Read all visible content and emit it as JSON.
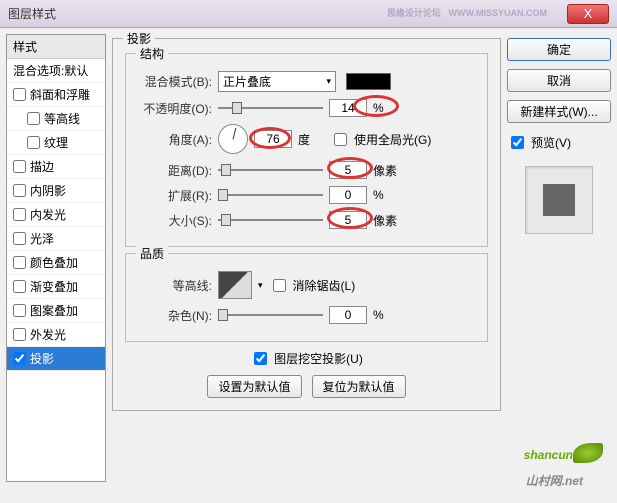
{
  "title": "图层样式",
  "watermark": {
    "text": "思缘设计论坛",
    "url": "WWW.MISSYUAN.COM"
  },
  "close_x": "X",
  "left": {
    "header": "样式",
    "blend_options": "混合选项:默认",
    "items": [
      {
        "label": "斜面和浮雕",
        "indent": false
      },
      {
        "label": "等高线",
        "indent": true
      },
      {
        "label": "纹理",
        "indent": true
      },
      {
        "label": "描边",
        "indent": false
      },
      {
        "label": "内阴影",
        "indent": false
      },
      {
        "label": "内发光",
        "indent": false
      },
      {
        "label": "光泽",
        "indent": false
      },
      {
        "label": "颜色叠加",
        "indent": false
      },
      {
        "label": "渐变叠加",
        "indent": false
      },
      {
        "label": "图案叠加",
        "indent": false
      },
      {
        "label": "外发光",
        "indent": false
      },
      {
        "label": "投影",
        "indent": false,
        "selected": true,
        "checked": true
      }
    ]
  },
  "center": {
    "title": "投影",
    "structure": {
      "legend": "结构",
      "blend_mode_label": "混合模式(B):",
      "blend_mode_value": "正片叠底",
      "opacity_label": "不透明度(O):",
      "opacity_value": "14",
      "opacity_unit": "%",
      "angle_label": "角度(A):",
      "angle_value": "76",
      "angle_unit": "度",
      "global_light": "使用全局光(G)",
      "distance_label": "距离(D):",
      "distance_value": "5",
      "distance_unit": "像素",
      "spread_label": "扩展(R):",
      "spread_value": "0",
      "spread_unit": "%",
      "size_label": "大小(S):",
      "size_value": "5",
      "size_unit": "像素"
    },
    "quality": {
      "legend": "品质",
      "contour_label": "等高线:",
      "antialias": "消除锯齿(L)",
      "noise_label": "杂色(N):",
      "noise_value": "0",
      "noise_unit": "%"
    },
    "knockout": "图层挖空投影(U)",
    "btn_default": "设置为默认值",
    "btn_reset": "复位为默认值"
  },
  "right": {
    "ok": "确定",
    "cancel": "取消",
    "new_style": "新建样式(W)...",
    "preview": "预览(V)"
  },
  "logo": {
    "text": "shancun",
    "net": ".net",
    "cn": "山村网"
  }
}
